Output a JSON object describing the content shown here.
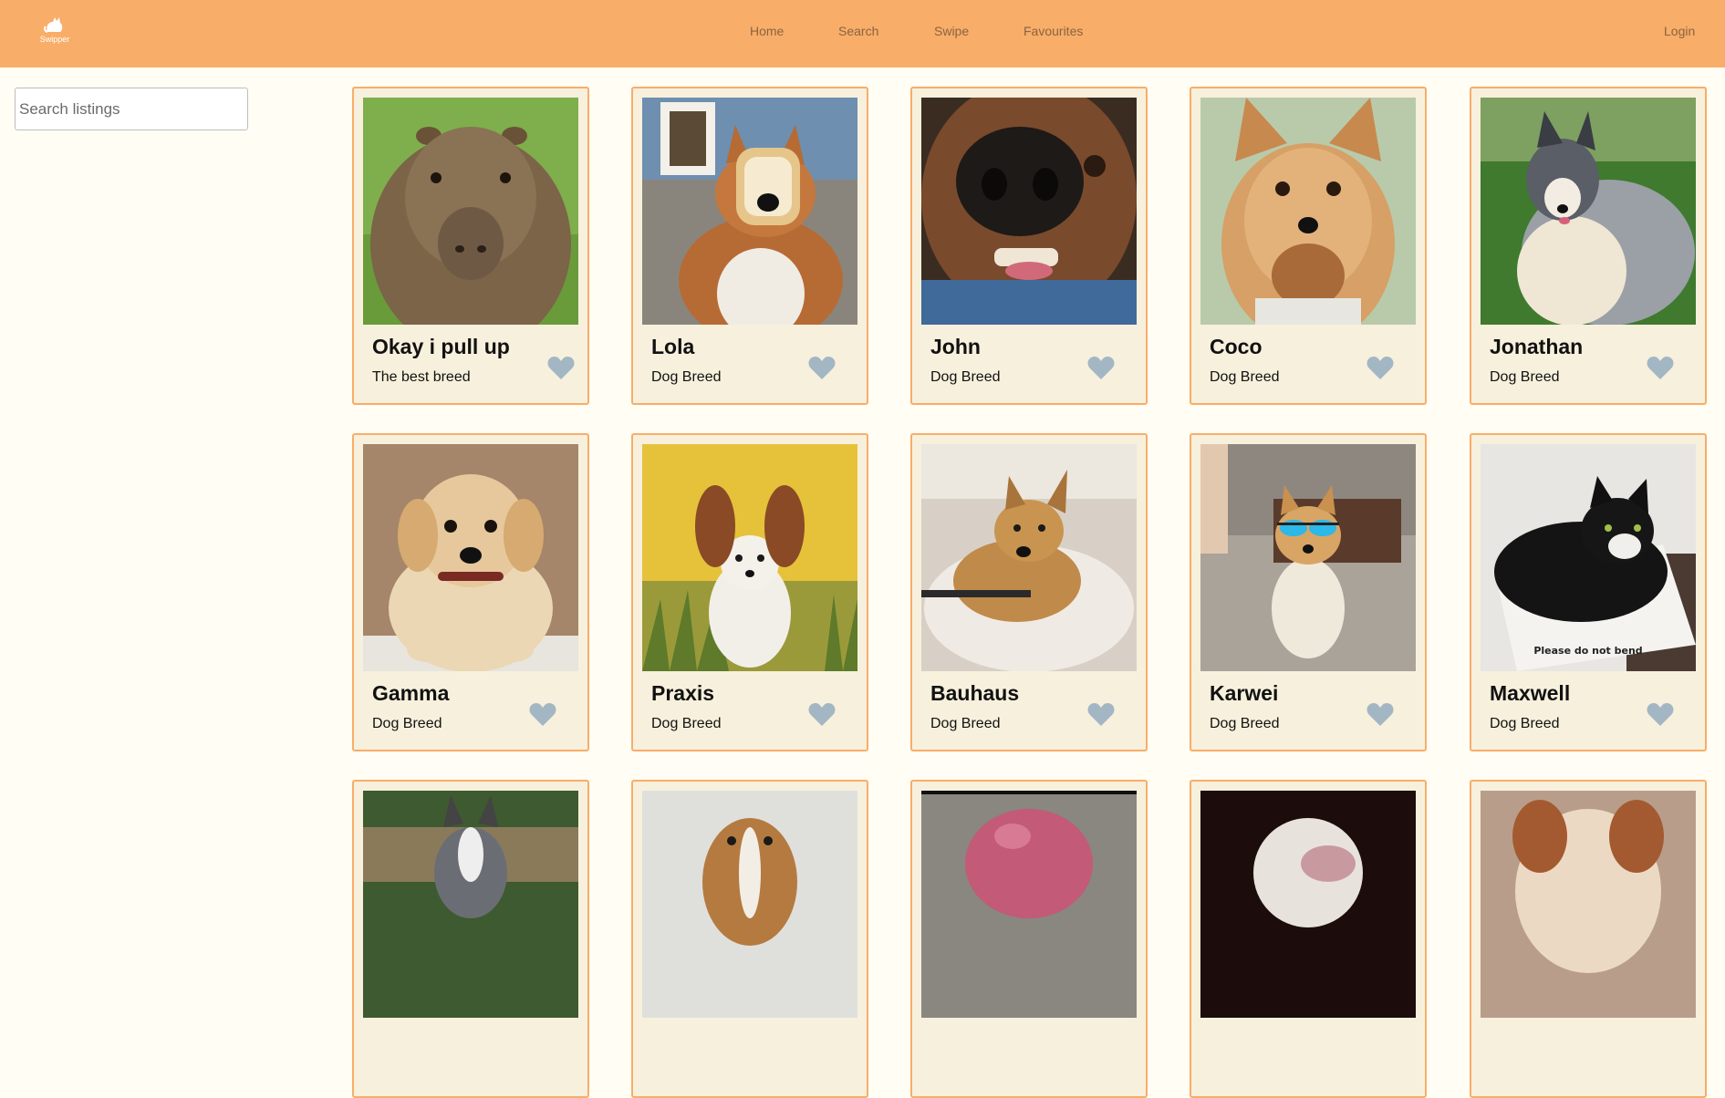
{
  "header": {
    "logo_text": "Swipper",
    "nav": [
      {
        "label": "Home"
      },
      {
        "label": "Search"
      },
      {
        "label": "Swipe"
      },
      {
        "label": "Favourites"
      }
    ],
    "login_label": "Login"
  },
  "search": {
    "placeholder": "Search listings"
  },
  "listings": [
    {
      "name": "Okay i pull up",
      "breed": "The best breed",
      "image": "capybara"
    },
    {
      "name": "Lola",
      "breed": "Dog Breed",
      "image": "corgi with bread"
    },
    {
      "name": "John",
      "breed": "Dog Breed",
      "image": "dog nose close-up"
    },
    {
      "name": "Coco",
      "breed": "Dog Breed",
      "image": "yorkshire terrier"
    },
    {
      "name": "Jonathan",
      "breed": "Dog Breed",
      "image": "sheltie"
    },
    {
      "name": "Gamma",
      "breed": "Dog Breed",
      "image": "golden retriever puppy"
    },
    {
      "name": "Praxis",
      "breed": "Dog Breed",
      "image": "papillon"
    },
    {
      "name": "Bauhaus",
      "breed": "Dog Breed",
      "image": "dog on bed"
    },
    {
      "name": "Karwei",
      "breed": "Dog Breed",
      "image": "dog with sunglasses"
    },
    {
      "name": "Maxwell",
      "breed": "Dog Breed",
      "image": "black cat"
    },
    {
      "name": "",
      "breed": "",
      "image": "husky"
    },
    {
      "name": "",
      "breed": "",
      "image": "beagle mix"
    },
    {
      "name": "",
      "breed": "",
      "image": "pink animal"
    },
    {
      "name": "",
      "breed": "",
      "image": "white dog dark background"
    },
    {
      "name": "",
      "breed": "",
      "image": "tan dog"
    }
  ],
  "photo_text": {
    "maxwell_box": "Please do not bend"
  },
  "colors": {
    "header": "#f8ad69",
    "card_bg": "#f7f0dc",
    "card_border": "#f8ad69",
    "heart": "#a3b6c4",
    "page_bg": "#fffdf4"
  }
}
